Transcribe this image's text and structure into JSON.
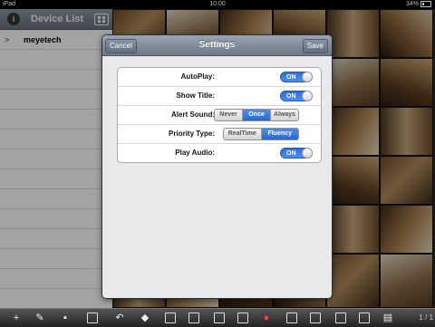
{
  "statusbar": {
    "device": "iPad",
    "time": "10:00",
    "battery": "34%"
  },
  "sidebar": {
    "title": "Device List",
    "info_glyph": "i",
    "devices": [
      {
        "name": "meyetech",
        "chevron": ">"
      }
    ]
  },
  "toolbar": {
    "counter": "1 / 1"
  },
  "modal": {
    "title": "Settings",
    "cancel_label": "Cancel",
    "save_label": "Save",
    "autoplay": {
      "label": "AutoPlay:",
      "value": "ON"
    },
    "show_title": {
      "label": "Show Title:",
      "value": "ON"
    },
    "alert_sound": {
      "label": "Alert Sound:",
      "options": [
        "Never",
        "Once",
        "Always"
      ],
      "selected": "Once"
    },
    "priority_type": {
      "label": "Priority Type:",
      "options": [
        "RealTime",
        "Fluency"
      ],
      "selected": "Fluency"
    },
    "play_audio": {
      "label": "Play Audio:",
      "value": "ON"
    }
  },
  "colors": {
    "accent": "#2f6fd6",
    "nav": "#7a8693"
  },
  "icons": [
    "info-icon",
    "grid-icon",
    "plus-icon",
    "pencil-icon",
    "trash-icon",
    "undo-icon",
    "ptz-icon",
    "snapshot-icon",
    "record-icon",
    "alarm-icon"
  ]
}
